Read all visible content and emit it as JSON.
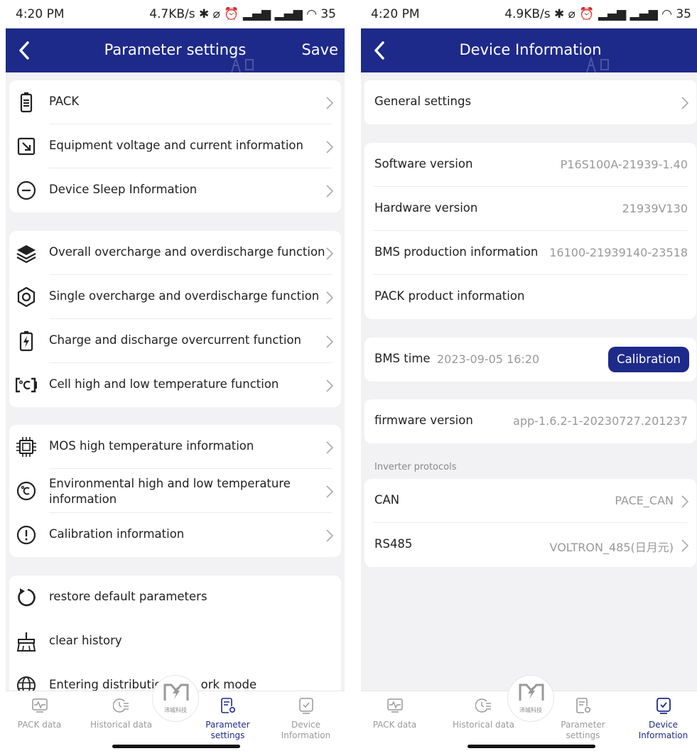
{
  "left": {
    "status": {
      "time": "4:20 PM",
      "icons": "4.7KB/s ✱ ⌀ ⏰ ▂▄▆ ▂▄▆ ◠ 35"
    },
    "nav": {
      "title": "Parameter settings",
      "save": "Save"
    },
    "group1": [
      {
        "label": "PACK",
        "icon": "battery-icon"
      },
      {
        "label": "Equipment voltage and current information",
        "icon": "voltage-arrow-icon"
      },
      {
        "label": "Device Sleep Information",
        "icon": "minus-circle-icon"
      }
    ],
    "group2": [
      {
        "label": "Overall overcharge and overdischarge function",
        "icon": "layers-icon"
      },
      {
        "label": "Single overcharge and overdischarge function",
        "icon": "hexagon-icon"
      },
      {
        "label": "Charge and discharge overcurrent function",
        "icon": "battery-bolt-icon"
      },
      {
        "label": "Cell high and low temperature function",
        "icon": "celsius-bracket-icon"
      }
    ],
    "group3": [
      {
        "label": "MOS high temperature information",
        "icon": "chip-icon"
      },
      {
        "label": "Environmental high and low temperature information",
        "icon": "celsius-circle-icon"
      },
      {
        "label": "Calibration information",
        "icon": "exclamation-circle-icon"
      }
    ],
    "group4": [
      {
        "label": "restore default parameters",
        "icon": "restore-icon"
      },
      {
        "label": "clear history",
        "icon": "broom-icon"
      },
      {
        "label": "Entering distributio",
        "label_tail": "ork mode",
        "icon": "globe-icon"
      }
    ]
  },
  "right": {
    "status": {
      "time": "4:20 PM",
      "icons": "4.9KB/s ✱ ⌀ ⏰ ▂▄▆ ▂▄▆ ◠ 35"
    },
    "nav": {
      "title": "Device Information"
    },
    "general": {
      "label": "General settings"
    },
    "versions": [
      {
        "label": "Software version",
        "value": "P16S100A-21939-1.40"
      },
      {
        "label": "Hardware version",
        "value": "21939V130"
      },
      {
        "label": "BMS production information",
        "value": "16100-21939140-23518"
      },
      {
        "label": "PACK product information",
        "value": ""
      }
    ],
    "bms_time": {
      "label": "BMS time",
      "value": "2023-09-05 16:20",
      "button": "Calibration"
    },
    "firmware": {
      "label": "firmware version",
      "value": "app-1.6.2-1-20230727.201237"
    },
    "inverter": {
      "section_label": "Inverter protocols",
      "rows": [
        {
          "label": "CAN",
          "value": "PACE_CAN"
        },
        {
          "label": "RS485",
          "value": "VOLTRON_485(日月元)"
        }
      ]
    }
  },
  "tabs": [
    {
      "label1": "PACK data",
      "label2": "",
      "icon": "pulse-monitor-icon"
    },
    {
      "label1": "Historical data",
      "label2": "",
      "icon": "clock-list-icon"
    },
    {
      "label1": "Parameter",
      "label2": "settings",
      "icon": "settings-doc-icon"
    },
    {
      "label1": "Device",
      "label2": "Information",
      "icon": "check-box-icon"
    }
  ],
  "logo": {
    "text": "沛城科技"
  },
  "colors": {
    "brand": "#1e2a8a",
    "background": "#f2f2f4",
    "muted": "#999999"
  }
}
